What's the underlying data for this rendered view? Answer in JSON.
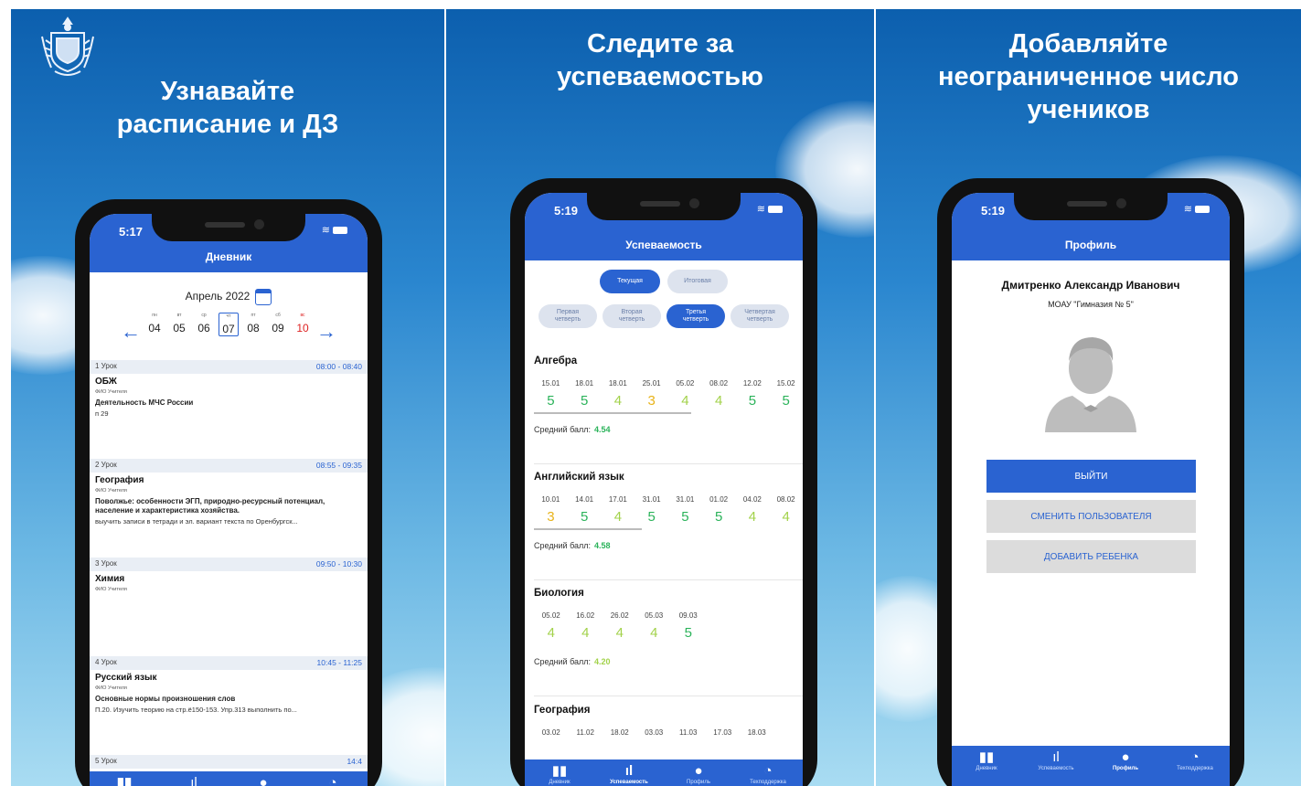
{
  "panels": [
    {
      "headline": [
        "Узнавайте",
        "расписание и ДЗ"
      ],
      "phone": {
        "time": "5:17",
        "title": "Дневник",
        "month": "Апрель 2022",
        "days": [
          {
            "name": "пн",
            "date": "04"
          },
          {
            "name": "вт",
            "date": "05"
          },
          {
            "name": "ср",
            "date": "06"
          },
          {
            "name": "чт",
            "date": "07"
          },
          {
            "name": "пт",
            "date": "08"
          },
          {
            "name": "сб",
            "date": "09"
          },
          {
            "name": "вс",
            "date": "10"
          }
        ],
        "selected_day": "07",
        "lessons": [
          {
            "num": "1 Урок",
            "time": "08:00 - 08:40",
            "subject": "ОБЖ",
            "teacher": "ФИО Учителя",
            "topic": "Деятельность МЧС России",
            "hw": "п 29"
          },
          {
            "num": "2 Урок",
            "time": "08:55 - 09:35",
            "subject": "География",
            "teacher": "ФИО Учителя",
            "topic": "Поволжье: особенности ЭГП, природно-ресурсный потенциал, население и характеристика хозяйства.",
            "hw": "выучить записи в тетради и эл. вариант текста по Оренбургск..."
          },
          {
            "num": "3 Урок",
            "time": "09:50 - 10:30",
            "subject": "Химия",
            "teacher": "ФИО Учителя",
            "topic": "",
            "hw": ""
          },
          {
            "num": "4 Урок",
            "time": "10:45 - 11:25",
            "subject": "Русский язык",
            "teacher": "ФИО Учителя",
            "topic": "Основные нормы произношения слов",
            "hw": "П.20. Изучить теорию на стр.ё150-153. Упр.313 выполнить по..."
          },
          {
            "num": "5 Урок",
            "time": "14:4",
            "subject": "",
            "teacher": "",
            "topic": "",
            "hw": ""
          }
        ]
      }
    },
    {
      "headline": [
        "Следите за",
        "успеваемостью"
      ],
      "phone": {
        "time": "5:19",
        "title": "Успеваемость",
        "toggle": [
          "Текущая",
          "Итоговая"
        ],
        "quarters": [
          [
            "Первая",
            "четверть"
          ],
          [
            "Вторая",
            "четверть"
          ],
          [
            "Третья",
            "четверть"
          ],
          [
            "Четвертая",
            "четверть"
          ]
        ],
        "avg_label": "Средний балл:",
        "subjects": [
          {
            "name": "Алгебра",
            "dates": [
              "15.01",
              "18.01",
              "18.01",
              "25.01",
              "05.02",
              "08.02",
              "12.02",
              "15.02"
            ],
            "grades": [
              "5",
              "5",
              "4",
              "3",
              "4",
              "4",
              "5",
              "5"
            ],
            "avg": "4.54"
          },
          {
            "name": "Английский язык",
            "dates": [
              "10.01",
              "14.01",
              "17.01",
              "31.01",
              "31.01",
              "01.02",
              "04.02",
              "08.02"
            ],
            "grades": [
              "3",
              "5",
              "4",
              "5",
              "5",
              "5",
              "4",
              "4"
            ],
            "avg": "4.58"
          },
          {
            "name": "Биология",
            "dates": [
              "05.02",
              "16.02",
              "26.02",
              "05.03",
              "09.03"
            ],
            "grades": [
              "4",
              "4",
              "4",
              "4",
              "5"
            ],
            "avg": "4.20"
          },
          {
            "name": "География",
            "dates": [
              "03.02",
              "11.02",
              "18.02",
              "03.03",
              "11.03",
              "17.03",
              "18.03"
            ],
            "grades": [],
            "avg": ""
          }
        ]
      }
    },
    {
      "headline": [
        "Добавляйте",
        "неограниченное число",
        "учеников"
      ],
      "phone": {
        "time": "5:19",
        "title": "Профиль",
        "name": "Дмитренко Александр Иванович",
        "school": "МОАУ \"Гимназия № 5\"",
        "buttons": {
          "logout": "ВЫЙТИ",
          "switch": "СМЕНИТЬ ПОЛЬЗОВАТЕЛЯ",
          "add": "ДОБАВИТЬ РЕБЕНКА"
        }
      }
    }
  ],
  "tabs": [
    "Дневник",
    "Успеваемость",
    "Профиль",
    "Техподдержка"
  ],
  "colors": {
    "primary": "#2a63d1",
    "grade5": "#2bb35a",
    "grade4": "#a2d24a",
    "grade3": "#e8b31a",
    "sunday": "#dd2222"
  }
}
